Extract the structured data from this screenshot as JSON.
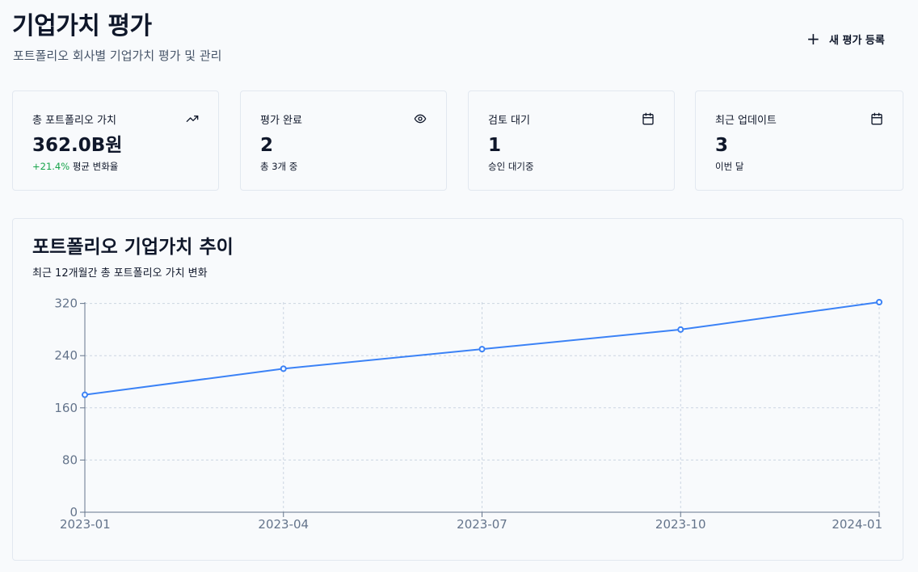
{
  "header": {
    "title": "기업가치 평가",
    "subtitle": "포트폴리오 회사별 기업가치 평가 및 관리",
    "new_button_label": "새 평가 등록"
  },
  "cards": [
    {
      "label": "총 포트폴리오 가치",
      "value": "362.0B원",
      "note_highlight": "+21.4%",
      "note": "평균 변화율",
      "icon": "trending-up-icon"
    },
    {
      "label": "평가 완료",
      "value": "2",
      "note_highlight": "",
      "note": "총 3개 중",
      "icon": "eye-icon"
    },
    {
      "label": "검토 대기",
      "value": "1",
      "note_highlight": "",
      "note": "승인 대기중",
      "icon": "calendar-icon"
    },
    {
      "label": "최근 업데이트",
      "value": "3",
      "note_highlight": "",
      "note": "이번 달",
      "icon": "calendar-icon"
    }
  ],
  "chart_section": {
    "title": "포트폴리오 기업가치 추이",
    "subtitle": "최근 12개월간 총 포트폴리오 가치 변화"
  },
  "chart_data": {
    "type": "line",
    "x": [
      "2023-01",
      "2023-04",
      "2023-07",
      "2023-10",
      "2024-01"
    ],
    "series": [
      {
        "values": [
          180,
          220,
          250,
          280,
          322
        ],
        "color": "#3b82f6"
      }
    ],
    "yticks": [
      0,
      80,
      160,
      240,
      320
    ],
    "ylim": [
      0,
      322
    ],
    "grid": true,
    "title": "",
    "xlabel": "",
    "ylabel": ""
  }
}
